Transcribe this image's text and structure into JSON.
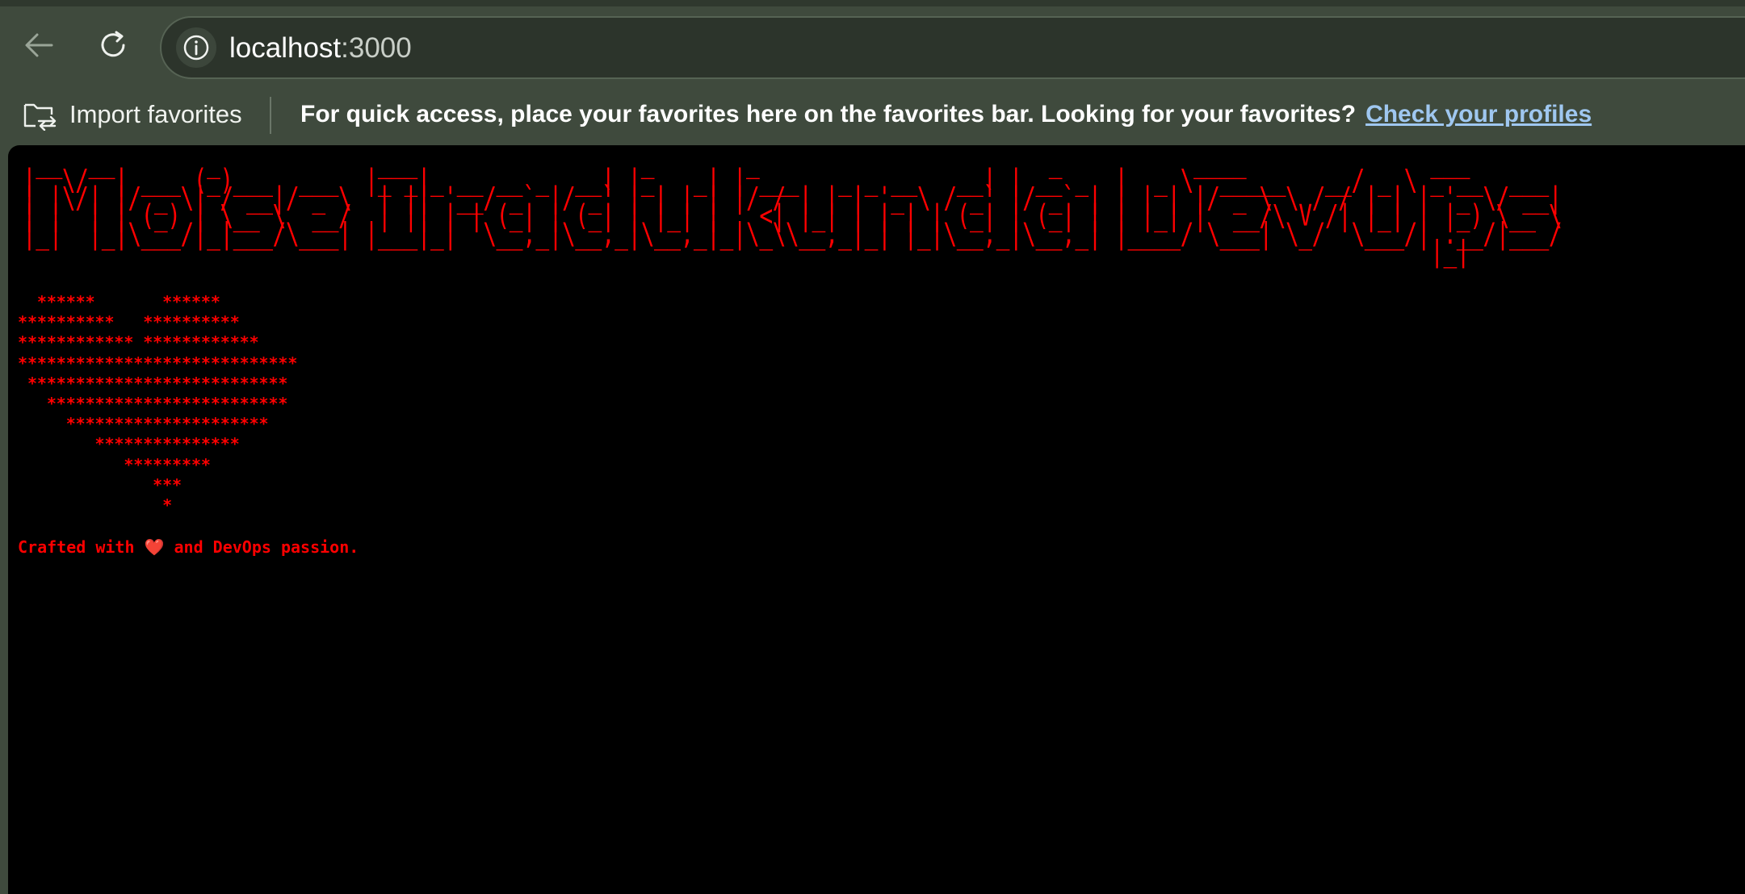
{
  "browser": {
    "url_host": "localhost",
    "url_port": ":3000",
    "back_icon": "back-arrow-icon",
    "reload_icon": "reload-icon",
    "site_info_icon": "info-icon"
  },
  "favorites_bar": {
    "import_label": "Import favorites",
    "message": "For quick access, place your favorites here on the favorites bar. Looking for your favorites?",
    "link_text": "Check your profiles"
  },
  "page": {
    "banner_ascii": " __  __       _            ___                 _       _                      _          ____              ___             \n|  \\/  | ___ (_)___  ___  |_ _|_ __ __ _  __| |_   _| | ___   _ _ __   __| | __ _  |  _ \\  _____   __/ _ \\ _ __  ___ \n| |\\/| |/ _ \\| / __|/ _ \\  | || '__/ _` |/ _` | | | | |/ / | | | '_ \\ / _` |/ _` | | | | |/ _ \\ \\ / / | | | '_ \\/ __|\n| |  | | (_) | \\__ \\  __/  | || | | (_| | (_| | |_| |   <| |_| | | | | (_| | (_| | | |_| |  __/\\ V /| |_| | |_) \\__ \\\n|_|  |_|\\___/|_|___/\\___| |___|_|  \\__,_|\\__,_|\\__,_|_|\\_\\\\__,_|_| |_|\\__,_|\\__,_| |____/ \\___| \\_/  \\___/| .__/|___/\n                                                                                                           |_|        ",
    "heart_ascii": "  ******       ******\n**********   **********\n************ ************\n*****************************\n ***************************\n   *************************\n     *********************\n        ***************\n           *********\n              ***\n               *",
    "tagline_prefix": "Crafted with ",
    "tagline_emoji": "❤️",
    "tagline_suffix": " and DevOps passion."
  },
  "colors": {
    "accent_text": "#ff0000",
    "page_background": "#000000",
    "chrome_background": "#3f4a3d",
    "link": "#9fc7f0"
  }
}
